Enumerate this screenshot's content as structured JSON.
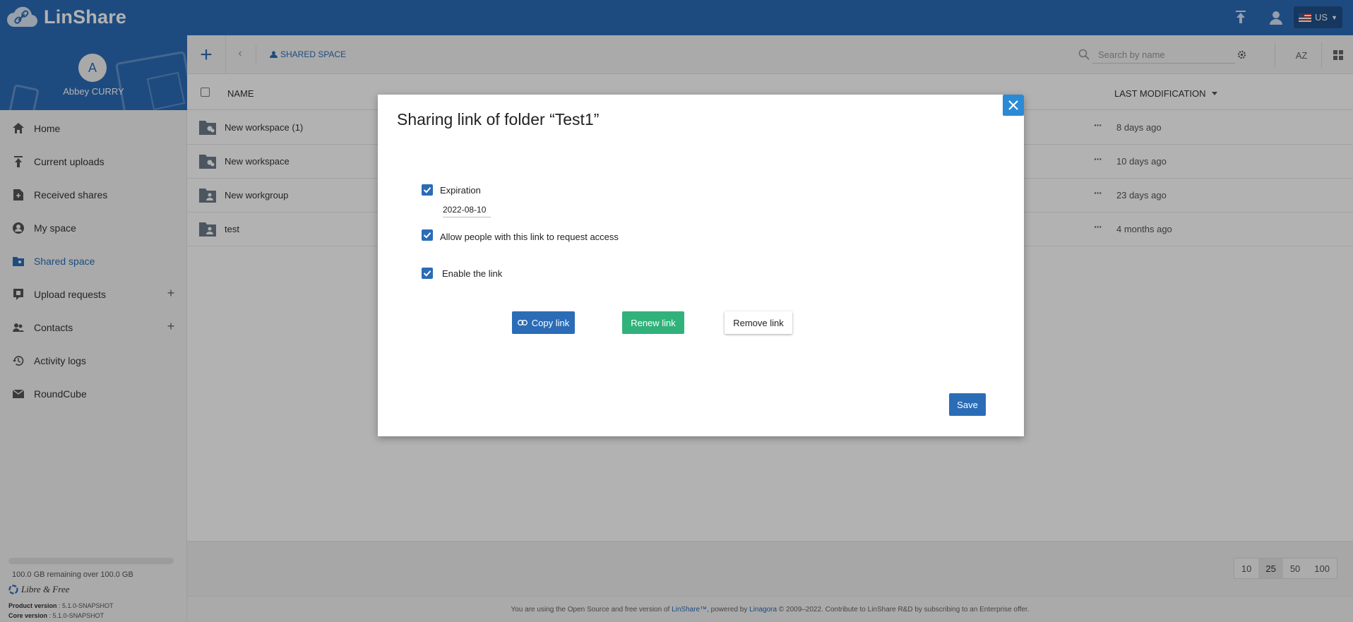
{
  "app": {
    "name": "LinShare"
  },
  "header": {
    "language": "US"
  },
  "profile": {
    "initial": "A",
    "name": "Abbey CURRY"
  },
  "sidebar": {
    "items": [
      {
        "label": "Home",
        "icon": "home-icon"
      },
      {
        "label": "Current uploads",
        "icon": "upload-icon"
      },
      {
        "label": "Received shares",
        "icon": "received-shares-icon"
      },
      {
        "label": "My space",
        "icon": "user-circle-icon"
      },
      {
        "label": "Shared space",
        "icon": "folder-shared-icon",
        "active": true
      },
      {
        "label": "Upload requests",
        "icon": "upload-request-icon",
        "plus": true
      },
      {
        "label": "Contacts",
        "icon": "contacts-icon",
        "plus": true
      },
      {
        "label": "Activity logs",
        "icon": "history-icon"
      },
      {
        "label": "RoundCube",
        "icon": "mail-icon"
      }
    ],
    "quota": {
      "text": "100.0 GB remaining over 100.0 GB",
      "used_fraction": 0.0
    },
    "brand": "Libre & Free",
    "product_version_label": "Product version",
    "product_version": ": 5.1.0-SNAPSHOT",
    "core_version_label": "Core version",
    "core_version": ": 5.1.0-SNAPSHOT"
  },
  "toolbar": {
    "breadcrumb": "SHARED SPACE",
    "search_placeholder": "Search by name",
    "sort_label": "AZ"
  },
  "table": {
    "headers": {
      "name": "NAME",
      "modified": "LAST MODIFICATION"
    },
    "rows": [
      {
        "name": "New workspace (1)",
        "modified": "8 days ago",
        "type": "workspace"
      },
      {
        "name": "New workspace",
        "modified": "10 days ago",
        "type": "workspace"
      },
      {
        "name": "New workgroup",
        "modified": "23 days ago",
        "type": "workgroup"
      },
      {
        "name": "test",
        "modified": "4 months ago",
        "type": "workgroup"
      }
    ]
  },
  "pager": {
    "sizes": [
      "10",
      "25",
      "50",
      "100"
    ],
    "selected": "25"
  },
  "footer": {
    "pre": "You are using the Open Source and free version of ",
    "product": "LinShare™",
    "mid": ", powered by ",
    "company": "Linagora",
    "post": " © 2009–2022. Contribute to LinShare R&D by subscribing to an Enterprise offer."
  },
  "modal": {
    "title": "Sharing link of folder “Test1”",
    "expiration_label": "Expiration",
    "expiration_checked": true,
    "expiration_date": "2022-08-10",
    "request_access_label": "Allow people with this link to request access",
    "request_access_checked": true,
    "enable_label": "Enable the link",
    "enable_checked": true,
    "copy_label": "Copy link",
    "renew_label": "Renew link",
    "remove_label": "Remove link",
    "save_label": "Save"
  },
  "colors": {
    "primary": "#2b6cb7",
    "renew": "#30b27a",
    "close": "#2b8ad6"
  }
}
